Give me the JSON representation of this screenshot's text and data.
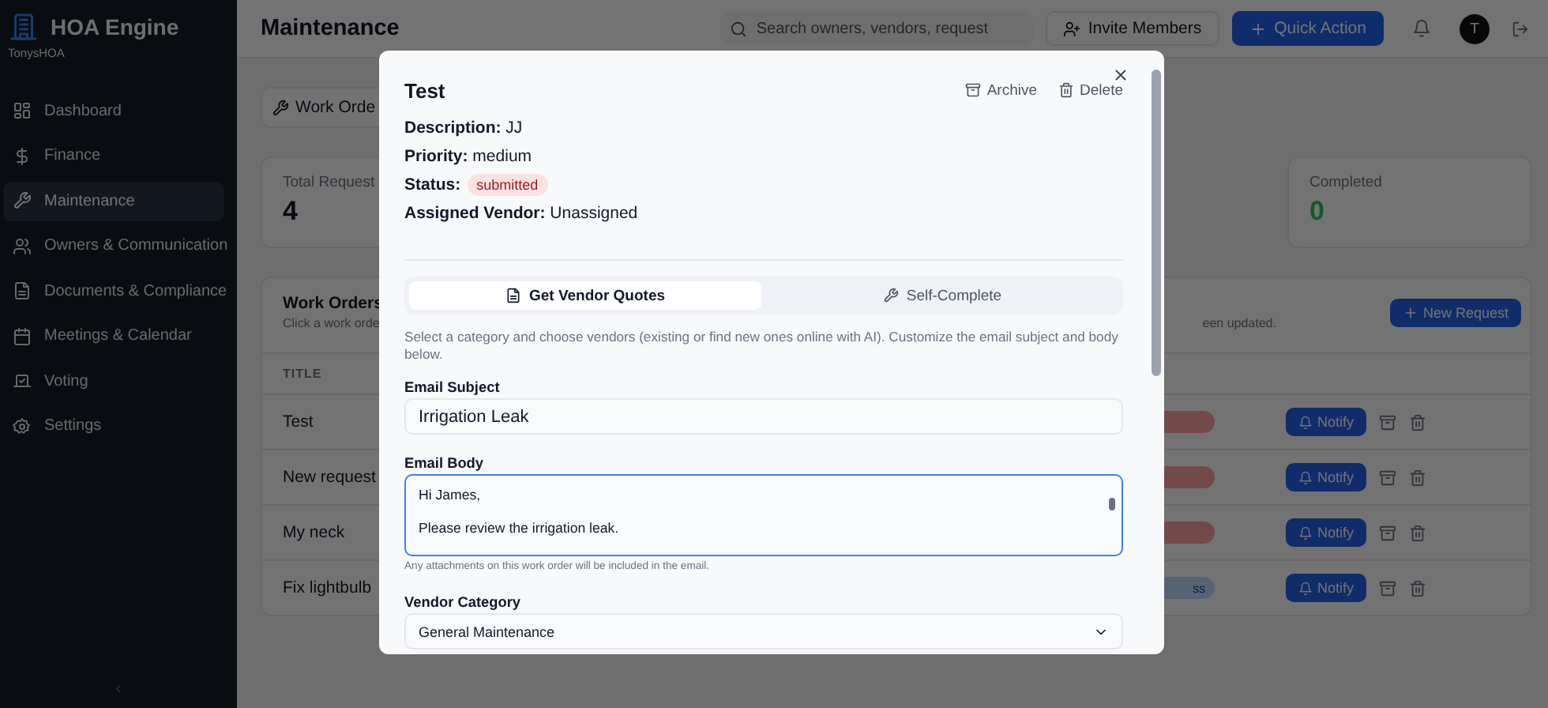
{
  "sidebar": {
    "app_name": "HOA Engine",
    "org": "TonysHOA",
    "items": [
      {
        "label": "Dashboard",
        "selected": false
      },
      {
        "label": "Finance",
        "selected": false
      },
      {
        "label": "Maintenance",
        "selected": true
      },
      {
        "label": "Owners & Communication",
        "selected": false
      },
      {
        "label": "Documents & Compliance",
        "selected": false
      },
      {
        "label": "Meetings & Calendar",
        "selected": false
      },
      {
        "label": "Voting",
        "selected": false
      },
      {
        "label": "Settings",
        "selected": false
      }
    ]
  },
  "header": {
    "title": "Maintenance",
    "search": {
      "placeholder": "Search owners, vendors, request"
    },
    "invite_button": "Invite Members",
    "quick_action_button": "Quick Action",
    "avatar": "T"
  },
  "page_tab": "Work Orde",
  "stats": [
    {
      "label": "Total Request",
      "value": "4",
      "kind": "total"
    },
    {
      "label": "Completed",
      "value": "0",
      "kind": "completed"
    }
  ],
  "work_orders": {
    "title": "Work Orders",
    "subtitle_left": "Click a work orde",
    "subtitle_right": "een updated.",
    "new_button": "New Request",
    "columns": [
      "TITLE"
    ],
    "rows": [
      {
        "title": "Test",
        "kind": "submitted",
        "notify": "Notify"
      },
      {
        "title": "New request",
        "kind": "submitted",
        "notify": "Notify"
      },
      {
        "title": "My neck",
        "kind": "submitted",
        "notify": "Notify"
      },
      {
        "title": "Fix lightbulb",
        "kind": "progress",
        "status_text": "ss",
        "notify": "Notify"
      }
    ]
  },
  "modal": {
    "title": "Test",
    "actions": [
      "Archive",
      "Delete"
    ],
    "fields": [
      {
        "kind": "text",
        "text": "**Description:** JJ"
      },
      {
        "kind": "text",
        "text": "**Priority:** medium"
      },
      {
        "kind": "badge",
        "label": "Status:",
        "value": "submitted"
      },
      {
        "kind": "text",
        "text": "**Assigned Vendor:** Unassigned"
      }
    ],
    "tabs": [
      {
        "label": "Get Vendor Quotes",
        "selected": true
      },
      {
        "label": "Self-Complete",
        "selected": false
      }
    ],
    "help": "Select a category and choose vendors (existing or find new ones online with AI). Customize the email subject and body below.",
    "email_subject": {
      "label": "Email Subject",
      "value": "Irrigation Leak"
    },
    "email_body": {
      "label": "Email Body",
      "value": "Hi James,\n\nPlease review the irrigation leak.",
      "focused": true
    },
    "attachments_hint": "Any attachments on this work order will be included in the email.",
    "vendor_category": {
      "label": "Vendor Category",
      "value": "General Maintenance"
    }
  }
}
